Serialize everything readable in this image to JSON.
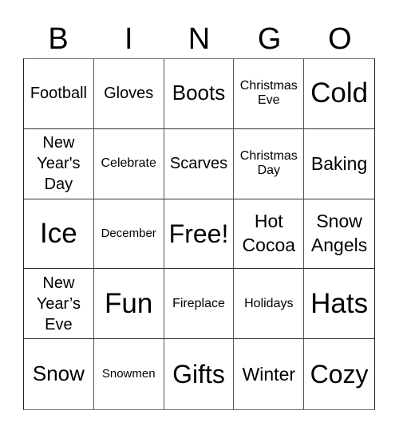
{
  "card": {
    "header": [
      "B",
      "I",
      "N",
      "G",
      "O"
    ],
    "rows": [
      [
        "Football",
        "Gloves",
        "Boots",
        "Christmas\nEve",
        "Cold"
      ],
      [
        "New\nYear's\nDay",
        "Celebrate",
        "Scarves",
        "Christmas\nDay",
        "Baking"
      ],
      [
        "Ice",
        "December",
        "Free!",
        "Hot\nCocoa",
        "Snow\nAngels"
      ],
      [
        "New\nYear’s\nEve",
        "Fun",
        "Fireplace",
        "Holidays",
        "Hats"
      ],
      [
        "Snow",
        "Snowmen",
        "Gifts",
        "Winter",
        "Cozy"
      ]
    ]
  }
}
